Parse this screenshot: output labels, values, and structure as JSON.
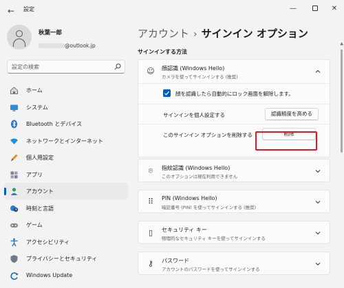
{
  "window": {
    "back_glyph": "←",
    "title": "設定",
    "minimize_glyph": "—",
    "close_glyph": "✕"
  },
  "user": {
    "name": "秋葉一郎",
    "email_domain": "@outlook.jp"
  },
  "search": {
    "placeholder": "設定の検索"
  },
  "nav": {
    "items": [
      {
        "label": "ホーム",
        "icon": "home-icon"
      },
      {
        "label": "システム",
        "icon": "system-icon"
      },
      {
        "label": "Bluetooth とデバイス",
        "icon": "bluetooth-icon"
      },
      {
        "label": "ネットワークとインターネット",
        "icon": "network-icon"
      },
      {
        "label": "個人用設定",
        "icon": "personalization-icon"
      },
      {
        "label": "アプリ",
        "icon": "apps-icon"
      },
      {
        "label": "アカウント",
        "icon": "accounts-icon",
        "active": true
      },
      {
        "label": "時刻と言語",
        "icon": "time-language-icon"
      },
      {
        "label": "ゲーム",
        "icon": "gaming-icon"
      },
      {
        "label": "アクセシビリティ",
        "icon": "accessibility-icon"
      },
      {
        "label": "プライバシーとセキュリティ",
        "icon": "privacy-shield-icon"
      },
      {
        "label": "Windows Update",
        "icon": "windows-update-icon"
      }
    ]
  },
  "main": {
    "breadcrumb_parent": "アカウント",
    "breadcrumb_sep": "›",
    "breadcrumb_current": "サインイン オプション",
    "section_title": "サインインする方法",
    "face": {
      "icon_glyph": "☺",
      "title": "顔認識 (Windows Hello)",
      "subtitle": "カメラを使ってサインインする (推奨)",
      "auto_dismiss_label": "顔を認識したら自動的にロック画面を解除します。",
      "auto_dismiss_checked": true,
      "personalize_label": "サインインを個人設定する",
      "improve_button": "認識精度を高める",
      "remove_label": "このサインイン オプションを削除する",
      "remove_button": "削除"
    },
    "options": [
      {
        "title": "指紋認識 (Windows Hello)",
        "subtitle": "このオプションは現在利用できません",
        "icon": "fingerprint-icon",
        "glyph": "⌾"
      },
      {
        "title": "PIN (Windows Hello)",
        "subtitle": "暗証番号 (PIN) を使ってサインインする (推奨)",
        "icon": "pin-keypad-icon",
        "glyph": "⠿"
      },
      {
        "title": "セキュリティ キー",
        "subtitle": "物理的なセキュリティ キーを使ってサインインする",
        "icon": "security-key-icon",
        "glyph": "▯"
      },
      {
        "title": "パスワード",
        "subtitle": "アカウントのパスワードを使ってサインインする",
        "icon": "key-icon",
        "glyph": "⚷"
      }
    ]
  },
  "colors": {
    "accent": "#005fb8",
    "highlight": "#e8141f",
    "background": "#f3f3f3",
    "card": "#fbfbfb"
  }
}
